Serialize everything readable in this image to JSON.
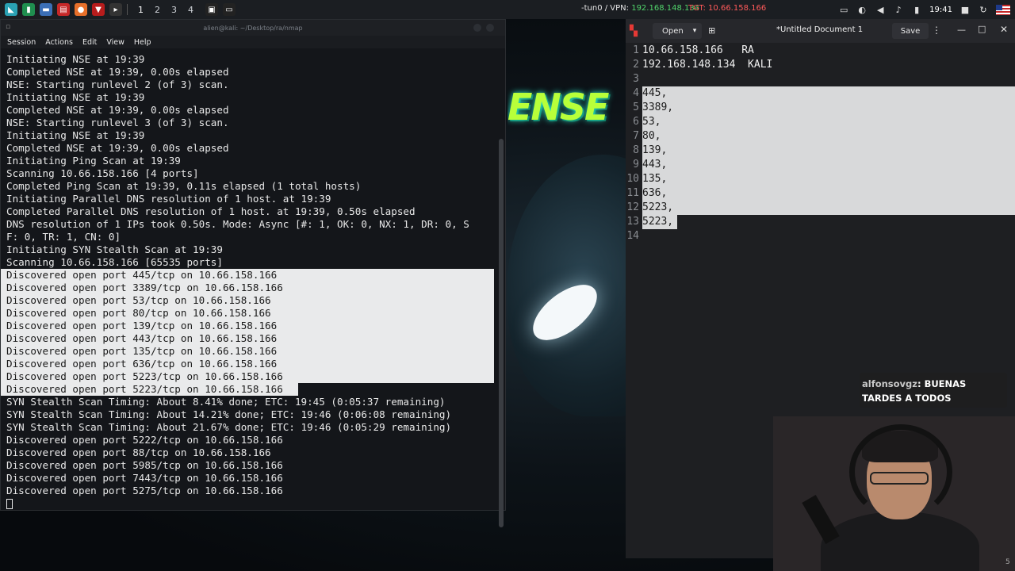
{
  "panel": {
    "workspaces": [
      "1",
      "2",
      "3",
      "4"
    ],
    "vpn_label": "-tun0 / VPN:",
    "vpn_ip": "192.168.148.134",
    "target": "TGT: 10.66.158.166",
    "clock": "19:41"
  },
  "terminal": {
    "title": "alien@kali: ~/Desktop/ra/nmap",
    "menu": [
      "Session",
      "Actions",
      "Edit",
      "View",
      "Help"
    ],
    "lines": [
      "Initiating NSE at 19:39",
      "Completed NSE at 19:39, 0.00s elapsed",
      "NSE: Starting runlevel 2 (of 3) scan.",
      "Initiating NSE at 19:39",
      "Completed NSE at 19:39, 0.00s elapsed",
      "NSE: Starting runlevel 3 (of 3) scan.",
      "Initiating NSE at 19:39",
      "Completed NSE at 19:39, 0.00s elapsed",
      "Initiating Ping Scan at 19:39",
      "Scanning 10.66.158.166 [4 ports]",
      "Completed Ping Scan at 19:39, 0.11s elapsed (1 total hosts)",
      "Initiating Parallel DNS resolution of 1 host. at 19:39",
      "Completed Parallel DNS resolution of 1 host. at 19:39, 0.50s elapsed",
      "DNS resolution of 1 IPs took 0.50s. Mode: Async [#: 1, OK: 0, NX: 1, DR: 0, S",
      "F: 0, TR: 1, CN: 0]",
      "Initiating SYN Stealth Scan at 19:39",
      "Scanning 10.66.158.166 [65535 ports]",
      "Discovered open port 445/tcp on 10.66.158.166",
      "Discovered open port 3389/tcp on 10.66.158.166",
      "Discovered open port 53/tcp on 10.66.158.166",
      "Discovered open port 80/tcp on 10.66.158.166",
      "Discovered open port 139/tcp on 10.66.158.166",
      "Discovered open port 443/tcp on 10.66.158.166",
      "Discovered open port 135/tcp on 10.66.158.166",
      "Discovered open port 636/tcp on 10.66.158.166",
      "Discovered open port 5223/tcp on 10.66.158.166",
      "Discovered open port 5223/tcp on 10.66.158.166",
      "SYN Stealth Scan Timing: About 8.41% done; ETC: 19:45 (0:05:37 remaining)",
      "SYN Stealth Scan Timing: About 14.21% done; ETC: 19:46 (0:06:08 remaining)",
      "SYN Stealth Scan Timing: About 21.67% done; ETC: 19:46 (0:05:29 remaining)",
      "Discovered open port 5222/tcp on 10.66.158.166",
      "Discovered open port 88/tcp on 10.66.158.166",
      "Discovered open port 5985/tcp on 10.66.158.166",
      "Discovered open port 7443/tcp on 10.66.158.166",
      "Discovered open port 5275/tcp on 10.66.158.166"
    ]
  },
  "editor": {
    "open_label": "Open",
    "title": "*Untitled Document 1",
    "save_label": "Save",
    "lines": [
      {
        "n": "1",
        "t": "10.66.158.166   RA"
      },
      {
        "n": "2",
        "t": "192.168.148.134  KALI"
      },
      {
        "n": "3",
        "t": ""
      },
      {
        "n": "4",
        "t": "445,"
      },
      {
        "n": "5",
        "t": "3389,"
      },
      {
        "n": "6",
        "t": "53,"
      },
      {
        "n": "7",
        "t": "80,"
      },
      {
        "n": "8",
        "t": "139,"
      },
      {
        "n": "9",
        "t": "443,"
      },
      {
        "n": "10",
        "t": "135,"
      },
      {
        "n": "11",
        "t": "636,"
      },
      {
        "n": "12",
        "t": "5223,"
      },
      {
        "n": "13",
        "t": "5223,"
      },
      {
        "n": "14",
        "t": ""
      }
    ]
  },
  "chat": {
    "user": "alfonsovgz",
    "message": ": BUENAS TARDES A TODOS"
  },
  "wallpaper_text": "ENSE",
  "corner_number": "5"
}
